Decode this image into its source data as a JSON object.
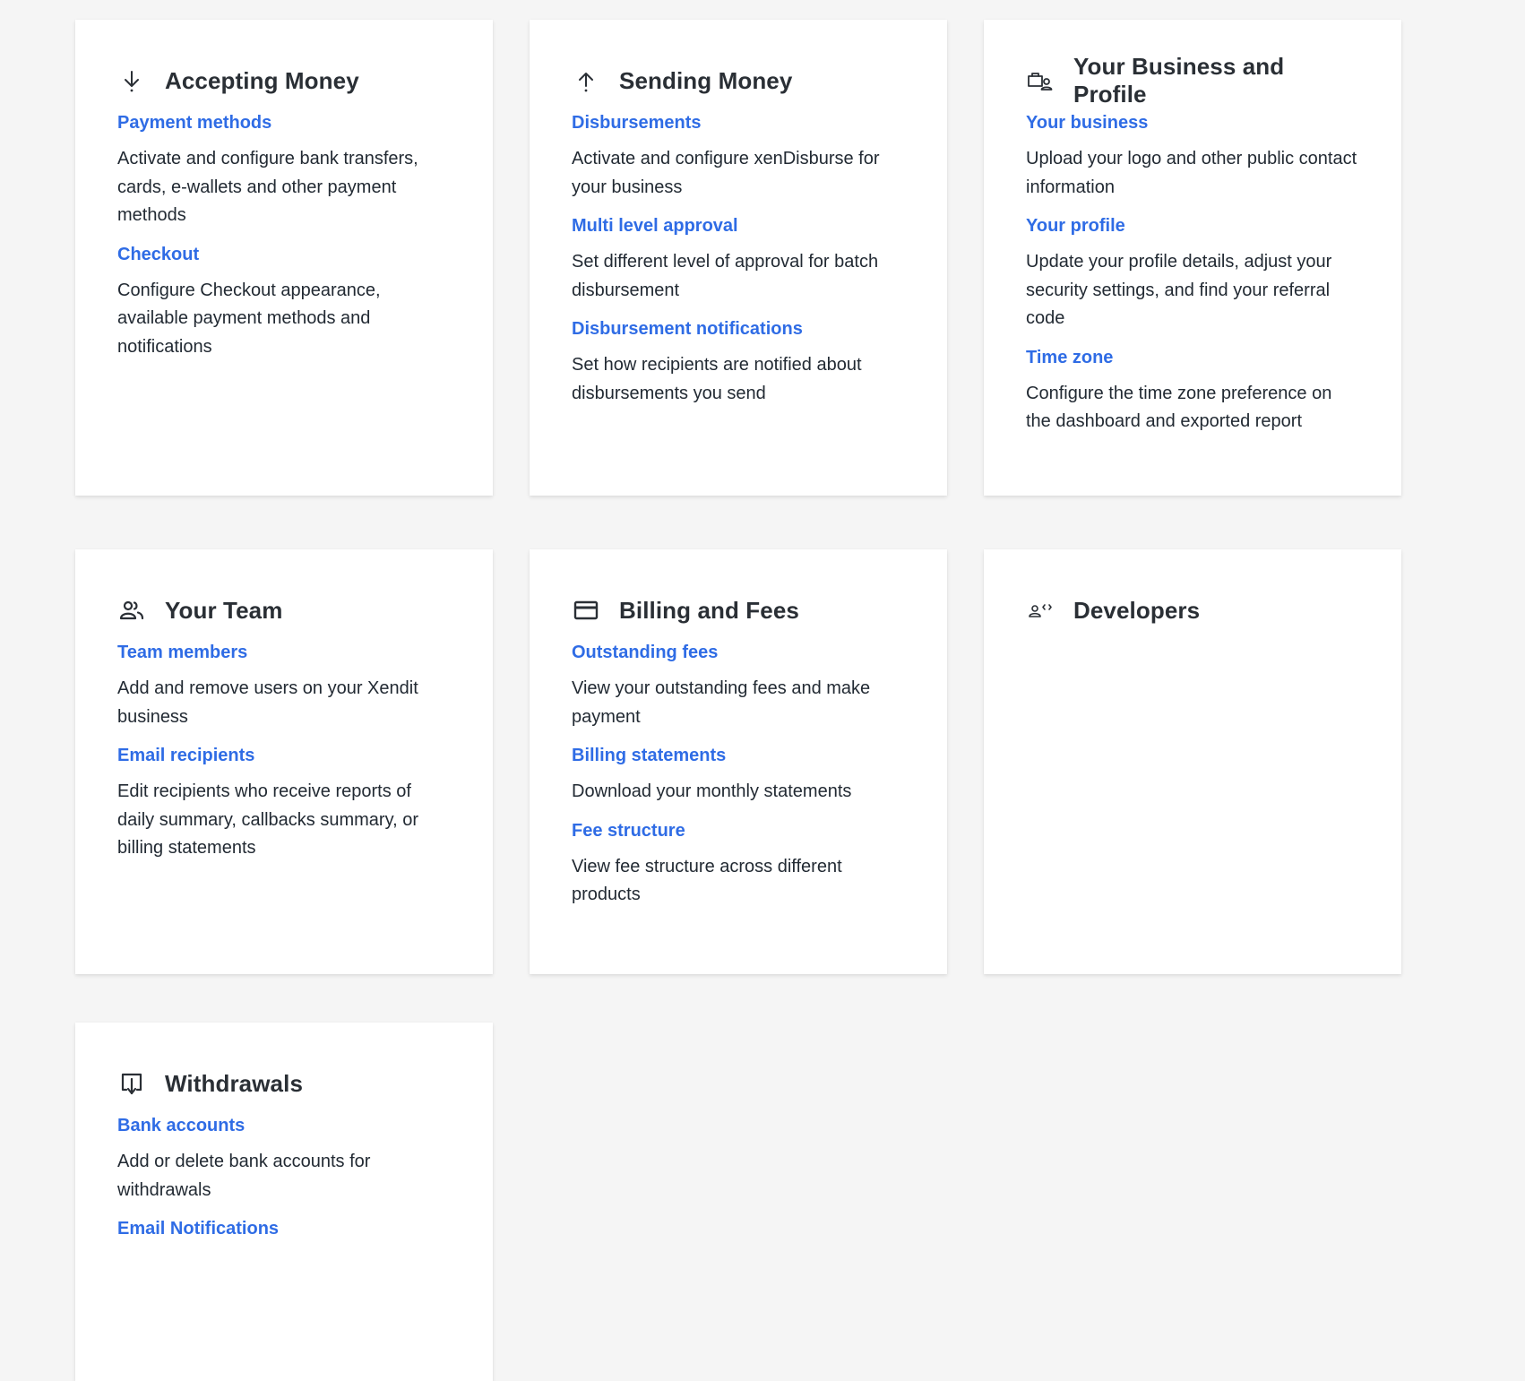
{
  "cards": [
    {
      "title": "Accepting Money",
      "icon": "arrow-down-icon",
      "sections": [
        {
          "link": "Payment methods",
          "desc": "Activate and configure bank transfers, cards, e-wallets and other payment methods"
        },
        {
          "link": "Checkout",
          "desc": "Configure Checkout appearance, available payment methods and notifications"
        }
      ]
    },
    {
      "title": "Sending Money",
      "icon": "arrow-up-icon",
      "sections": [
        {
          "link": "Disbursements",
          "desc": "Activate and configure xenDisburse for your business"
        },
        {
          "link": "Multi level approval",
          "desc": "Set different level of approval for batch disbursement"
        },
        {
          "link": "Disbursement notifications",
          "desc": "Set how recipients are notified about disbursements you send"
        }
      ]
    },
    {
      "title": "Your Business and Profile",
      "icon": "business-profile-icon",
      "sections": [
        {
          "link": "Your business",
          "desc": "Upload your logo and other public contact information"
        },
        {
          "link": "Your profile",
          "desc": "Update your profile details, adjust your security settings, and find your referral code"
        },
        {
          "link": "Time zone",
          "desc": "Configure the time zone preference on the dashboard and exported report"
        }
      ]
    },
    {
      "title": "Your Team",
      "icon": "team-icon",
      "sections": [
        {
          "link": "Team members",
          "desc": "Add and remove users on your Xendit business"
        },
        {
          "link": "Email recipients",
          "desc": "Edit recipients who receive reports of daily summary, callbacks summary, or billing statements"
        }
      ]
    },
    {
      "title": "Billing and Fees",
      "icon": "credit-card-icon",
      "sections": [
        {
          "link": "Outstanding fees",
          "desc": "View your outstanding fees and make payment"
        },
        {
          "link": "Billing statements",
          "desc": "Download your monthly statements"
        },
        {
          "link": "Fee structure",
          "desc": "View fee structure across different products"
        }
      ]
    },
    {
      "title": "Developers",
      "icon": "developer-icon",
      "sections": []
    },
    {
      "title": "Withdrawals",
      "icon": "withdraw-icon",
      "sections": [
        {
          "link": "Bank accounts",
          "desc": "Add or delete bank accounts for withdrawals"
        },
        {
          "link": "Email Notifications",
          "desc": ""
        }
      ]
    }
  ],
  "colors": {
    "background": "#f5f5f5",
    "card": "#ffffff",
    "link": "#2f6ce5",
    "text": "#222a33",
    "icon": "#2a2f35"
  }
}
